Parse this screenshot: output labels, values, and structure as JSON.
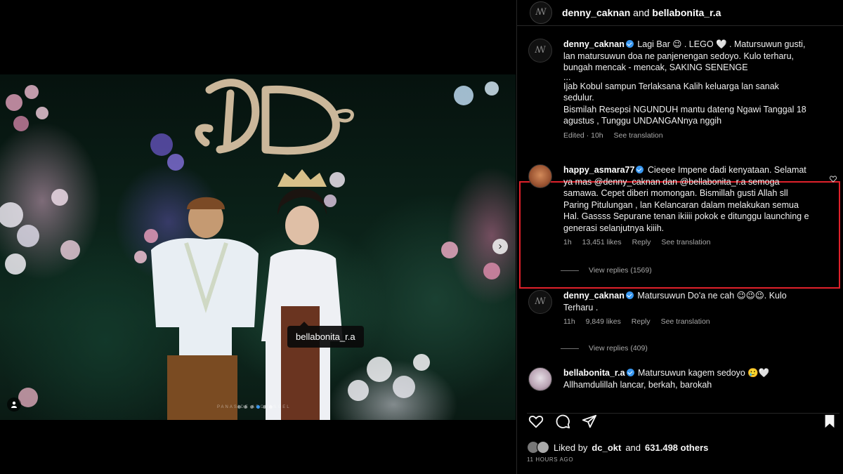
{
  "header": {
    "user1": "denny_caknan",
    "conj": "and",
    "user2": "bellabonita_r.a"
  },
  "media": {
    "usertag": "bellabonita_r.a",
    "slide_count": 6,
    "active_slide": 4,
    "watermark": "PANASIDE ARCHANGEL"
  },
  "comments": [
    {
      "user": "denny_caknan",
      "verified": true,
      "text": "Lagi Bar 😉 . LEGO 🤍 . Matursuwun gusti, lan matursuwun doa ne panjenengan sedoyo. Kulo terharu, bungah mencak - mencak, SAKING SENENGE",
      "text2": "...",
      "text3": "Ijab Kobul sampun Terlaksana Kalih keluarga lan sanak sedulur.",
      "text4": "Bismilah Resepsi NGUNDUH mantu dateng Ngawi Tanggal 18 agustus , Tunggu UNDANGANnya nggih",
      "edited": "Edited · 10h",
      "see_translation": "See translation"
    },
    {
      "user": "happy_asmara77",
      "verified": true,
      "text": "Cieeee Impene dadi kenyataan. Selamat ya mas @denny_caknan dan @bellabonita_r.a semoga samawa. Cepet diberi momongan. Bismillah gusti Allah sll Paring Pitulungan , lan Kelancaran dalam melakukan semua Hal. Gassss Sepurane tenan ikiiii pokok e ditunggu launching e generasi selanjutnya kiiih.",
      "time": "1h",
      "likes": "13,451 likes",
      "reply": "Reply",
      "see_translation": "See translation",
      "view_replies": "View replies (1569)"
    },
    {
      "user": "denny_caknan",
      "verified": true,
      "text": "Matursuwun Do'a ne cah 😉😉😉. Kulo Terharu .",
      "time": "11h",
      "likes": "9,849 likes",
      "reply": "Reply",
      "see_translation": "See translation",
      "view_replies": "View replies (409)"
    },
    {
      "user": "bellabonita_r.a",
      "verified": true,
      "text": "Matursuwun kagem sedoyo 🥲🤍",
      "text2": "Allhamdulillah lancar, berkah, barokah"
    }
  ],
  "footer": {
    "liked_by": "Liked by",
    "liker": "dc_okt",
    "and": "and",
    "others": "631.498 others",
    "timestamp": "11 HOURS AGO"
  },
  "colors": {
    "background": "#000000",
    "highlight_border": "#e0212b",
    "verified": "#3897f0",
    "muted_text": "#a8a8a8"
  }
}
